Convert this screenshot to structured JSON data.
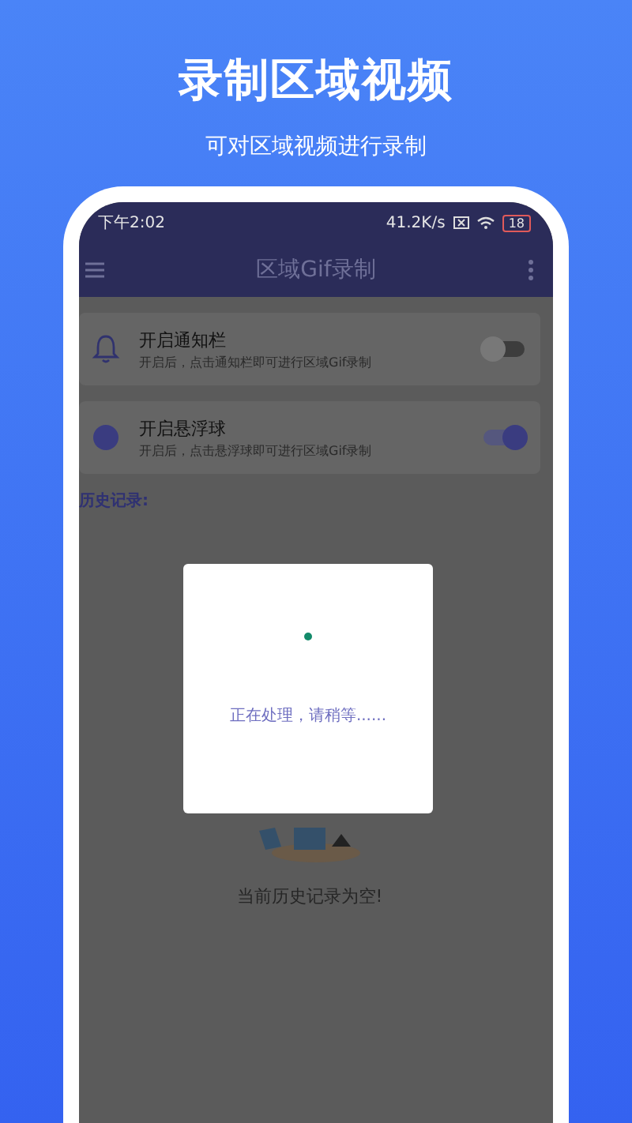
{
  "headline": "录制区域视频",
  "subtitle": "可对区域视频进行录制",
  "status_bar": {
    "time": "下午2:02",
    "speed": "41.2K/s",
    "battery": "18"
  },
  "app_bar": {
    "title": "区域Gif录制"
  },
  "settings": [
    {
      "kind": "bell",
      "title": "开启通知栏",
      "description": "开启后，点击通知栏即可进行区域Gif录制",
      "on": false
    },
    {
      "kind": "ball",
      "title": "开启悬浮球",
      "description": "开启后，点击悬浮球即可进行区域Gif录制",
      "on": true
    }
  ],
  "history": {
    "label": "历史记录:",
    "empty_text": "当前历史记录为空!"
  },
  "dialog": {
    "message": "正在处理，请稍等......"
  }
}
